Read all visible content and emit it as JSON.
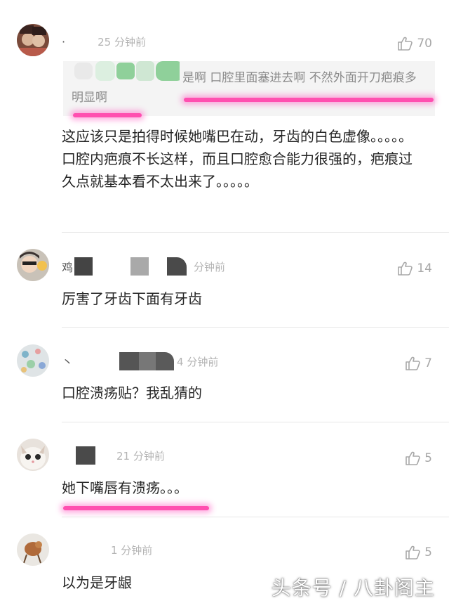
{
  "comments": [
    {
      "name": "·",
      "time": "25 分钟前",
      "likes": "70",
      "quote": "是啊 口腔里面塞进去啊 不然外面开刀疤痕多明显啊",
      "content_lines": [
        "这应该只是拍得时候她嘴巴在动，牙齿的白色虚像。。。。。",
        "口腔内疤痕不长这样，而且口腔愈合能力很强的，疤痕过久点就基本看不太出来了。。。。。"
      ]
    },
    {
      "name": "鸡",
      "time": "分钟前",
      "likes": "14",
      "content": "厉害了牙齿下面有牙齿"
    },
    {
      "name": "丶",
      "time": "4 分钟前",
      "likes": "7",
      "content": "口腔溃疡贴？我乱猜的"
    },
    {
      "name": "",
      "time": "21 分钟前",
      "likes": "5",
      "content": "她下嘴唇有溃疡。。。"
    },
    {
      "name": "",
      "time": "1 分钟前",
      "likes": "5",
      "content": "以为是牙龈"
    }
  ],
  "watermark": "头条号 / 八卦阁主",
  "colors": {
    "highlight": "#ff4fb0",
    "meta_text": "#b4b4b4",
    "quote_bg": "#f4f4f4"
  },
  "icons": {
    "like": "thumbs-up-icon"
  }
}
